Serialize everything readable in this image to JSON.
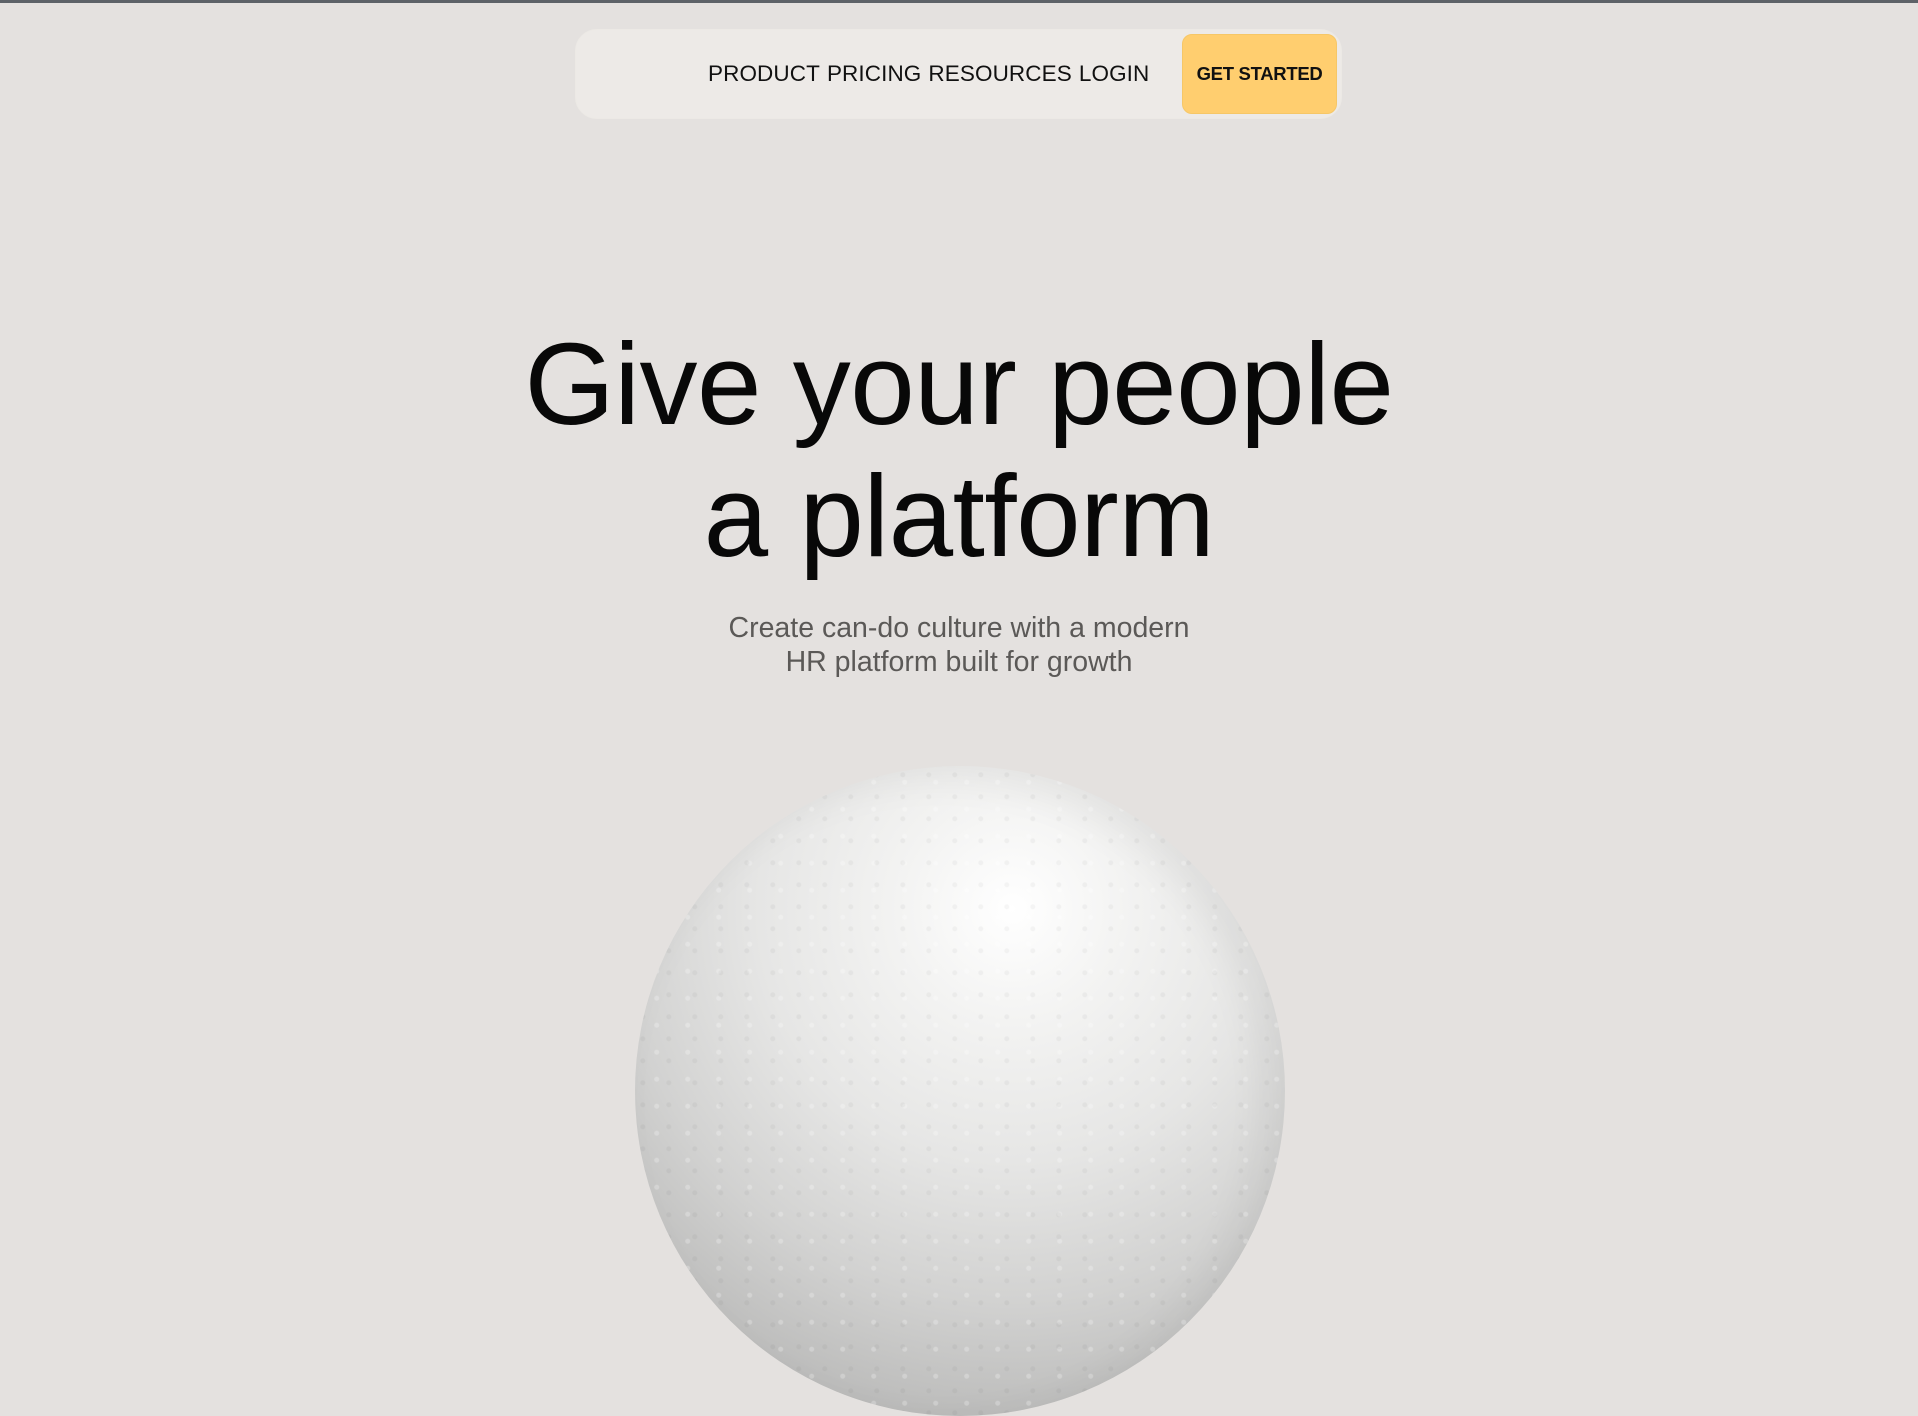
{
  "nav": {
    "links": [
      "PRODUCT",
      "PRICING",
      "RESOURCES",
      "LOGIN"
    ],
    "cta_label": "GET STARTED",
    "cta_color": "#ffce6f",
    "pill_color": "#edeae7"
  },
  "hero": {
    "title_line1": "Give your people",
    "title_line2": "a platform",
    "subtitle_line1": "Create can-do culture with a modern",
    "subtitle_line2": "HR platform built for growth"
  },
  "page": {
    "background_color": "#e4e1df"
  }
}
